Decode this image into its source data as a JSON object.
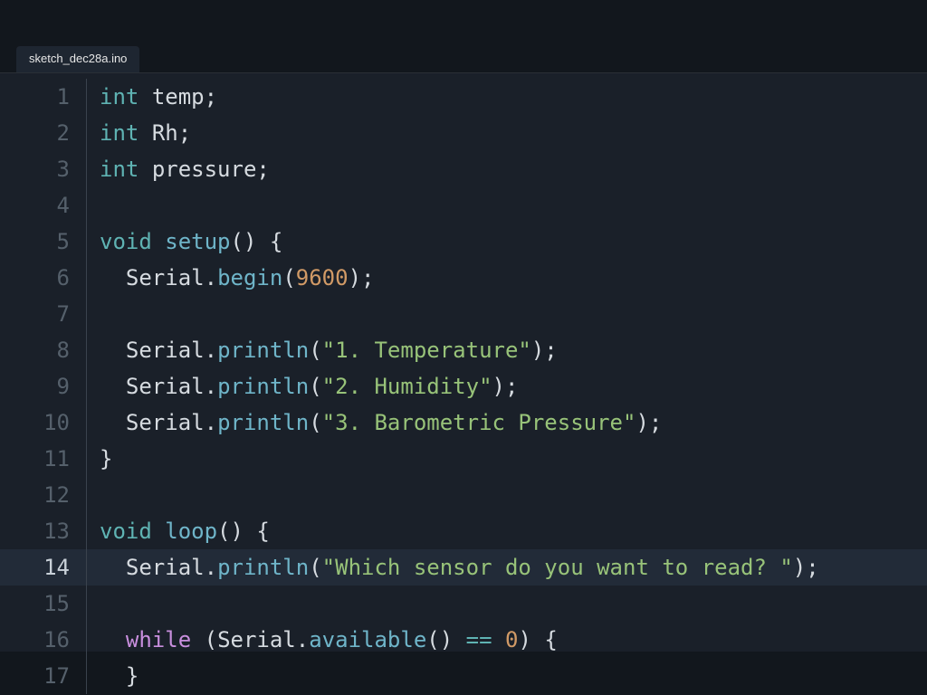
{
  "tab": {
    "filename": "sketch_dec28a.ino"
  },
  "editor": {
    "active_line": 14,
    "lines": [
      {
        "n": 1,
        "tokens": [
          [
            "type",
            "int"
          ],
          [
            "plain",
            " "
          ],
          [
            "ident",
            "temp"
          ],
          [
            "punc",
            ";"
          ]
        ]
      },
      {
        "n": 2,
        "tokens": [
          [
            "type",
            "int"
          ],
          [
            "plain",
            " "
          ],
          [
            "ident",
            "Rh"
          ],
          [
            "punc",
            ";"
          ]
        ]
      },
      {
        "n": 3,
        "tokens": [
          [
            "type",
            "int"
          ],
          [
            "plain",
            " "
          ],
          [
            "ident",
            "pressure"
          ],
          [
            "punc",
            ";"
          ]
        ]
      },
      {
        "n": 4,
        "tokens": []
      },
      {
        "n": 5,
        "tokens": [
          [
            "type",
            "void"
          ],
          [
            "plain",
            " "
          ],
          [
            "func",
            "setup"
          ],
          [
            "punc",
            "()"
          ],
          [
            "plain",
            " "
          ],
          [
            "punc",
            "{"
          ]
        ]
      },
      {
        "n": 6,
        "tokens": [
          [
            "plain",
            "  "
          ],
          [
            "obj",
            "Serial"
          ],
          [
            "punc",
            "."
          ],
          [
            "func",
            "begin"
          ],
          [
            "punc",
            "("
          ],
          [
            "num",
            "9600"
          ],
          [
            "punc",
            ");"
          ]
        ]
      },
      {
        "n": 7,
        "tokens": []
      },
      {
        "n": 8,
        "tokens": [
          [
            "plain",
            "  "
          ],
          [
            "obj",
            "Serial"
          ],
          [
            "punc",
            "."
          ],
          [
            "func",
            "println"
          ],
          [
            "punc",
            "("
          ],
          [
            "str",
            "\"1. Temperature\""
          ],
          [
            "punc",
            ");"
          ]
        ]
      },
      {
        "n": 9,
        "tokens": [
          [
            "plain",
            "  "
          ],
          [
            "obj",
            "Serial"
          ],
          [
            "punc",
            "."
          ],
          [
            "func",
            "println"
          ],
          [
            "punc",
            "("
          ],
          [
            "str",
            "\"2. Humidity\""
          ],
          [
            "punc",
            ");"
          ]
        ]
      },
      {
        "n": 10,
        "tokens": [
          [
            "plain",
            "  "
          ],
          [
            "obj",
            "Serial"
          ],
          [
            "punc",
            "."
          ],
          [
            "func",
            "println"
          ],
          [
            "punc",
            "("
          ],
          [
            "str",
            "\"3. Barometric Pressure\""
          ],
          [
            "punc",
            ");"
          ]
        ]
      },
      {
        "n": 11,
        "tokens": [
          [
            "punc",
            "}"
          ]
        ]
      },
      {
        "n": 12,
        "tokens": []
      },
      {
        "n": 13,
        "tokens": [
          [
            "type",
            "void"
          ],
          [
            "plain",
            " "
          ],
          [
            "func",
            "loop"
          ],
          [
            "punc",
            "()"
          ],
          [
            "plain",
            " "
          ],
          [
            "punc",
            "{"
          ]
        ]
      },
      {
        "n": 14,
        "tokens": [
          [
            "plain",
            "  "
          ],
          [
            "obj",
            "Serial"
          ],
          [
            "punc",
            "."
          ],
          [
            "func",
            "println"
          ],
          [
            "punc",
            "("
          ],
          [
            "str",
            "\"Which sensor do you want to read? \""
          ],
          [
            "punc",
            ");"
          ]
        ]
      },
      {
        "n": 15,
        "tokens": []
      },
      {
        "n": 16,
        "tokens": [
          [
            "plain",
            "  "
          ],
          [
            "kw",
            "while"
          ],
          [
            "plain",
            " "
          ],
          [
            "punc",
            "("
          ],
          [
            "obj",
            "Serial"
          ],
          [
            "punc",
            "."
          ],
          [
            "func",
            "available"
          ],
          [
            "punc",
            "()"
          ],
          [
            "plain",
            " "
          ],
          [
            "op",
            "=="
          ],
          [
            "plain",
            " "
          ],
          [
            "num",
            "0"
          ],
          [
            "punc",
            ")"
          ],
          [
            "plain",
            " "
          ],
          [
            "punc",
            "{"
          ]
        ]
      },
      {
        "n": 17,
        "tokens": [
          [
            "plain",
            "  "
          ],
          [
            "punc",
            "}"
          ]
        ]
      }
    ]
  },
  "token_classes": {
    "type": "tk-type",
    "ident": "tk-ident",
    "func": "tk-func",
    "obj": "tk-obj",
    "kw": "tk-kw",
    "num": "tk-num",
    "str": "tk-str",
    "punc": "tk-punc",
    "op": "tk-op",
    "plain": "tk-ident"
  }
}
